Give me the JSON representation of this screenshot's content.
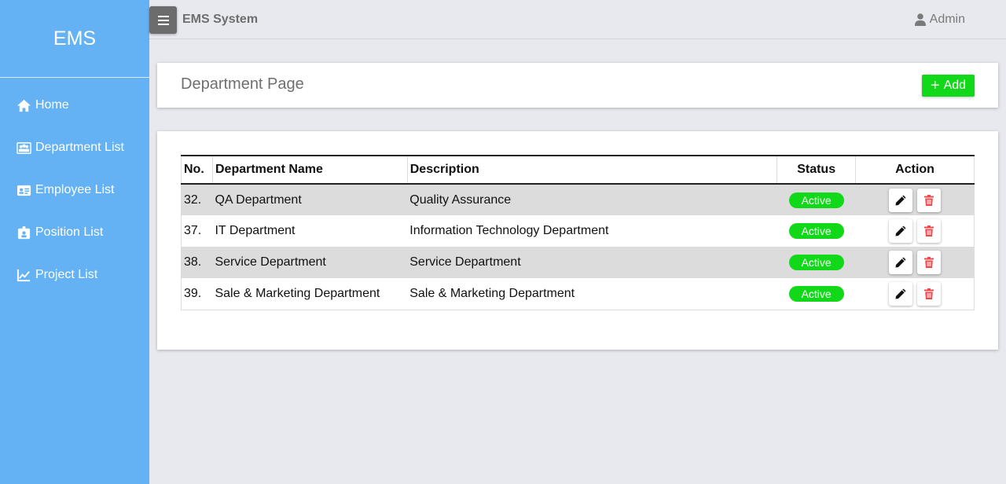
{
  "sidebar": {
    "brand": "EMS",
    "items": [
      {
        "label": "Home",
        "icon": "home-icon"
      },
      {
        "label": "Department List",
        "icon": "users-icon"
      },
      {
        "label": "Employee List",
        "icon": "id-card-icon"
      },
      {
        "label": "Position List",
        "icon": "id-badge-icon"
      },
      {
        "label": "Project List",
        "icon": "chart-line-icon"
      }
    ]
  },
  "topbar": {
    "title": "EMS System",
    "user": "Admin",
    "menu_icon": "hamburger-icon",
    "user_icon": "user-icon"
  },
  "page": {
    "title": "Department Page",
    "add_label": "Add"
  },
  "table": {
    "headers": {
      "no": "No.",
      "name": "Department Name",
      "description": "Description",
      "status": "Status",
      "action": "Action"
    },
    "rows": [
      {
        "no": "32.",
        "name": "QA Department",
        "description": "Quality Assurance",
        "status": "Active"
      },
      {
        "no": "37.",
        "name": "IT Department",
        "description": "Information Technology Department",
        "status": "Active"
      },
      {
        "no": "38.",
        "name": "Service Department",
        "description": "Service Department",
        "status": "Active"
      },
      {
        "no": "39.",
        "name": "Sale & Marketing Department",
        "description": "Sale & Marketing Department",
        "status": "Active"
      }
    ]
  },
  "colors": {
    "sidebar": "#64b2f4",
    "accent_green": "#12d81a",
    "delete_red": "#f0474b"
  }
}
